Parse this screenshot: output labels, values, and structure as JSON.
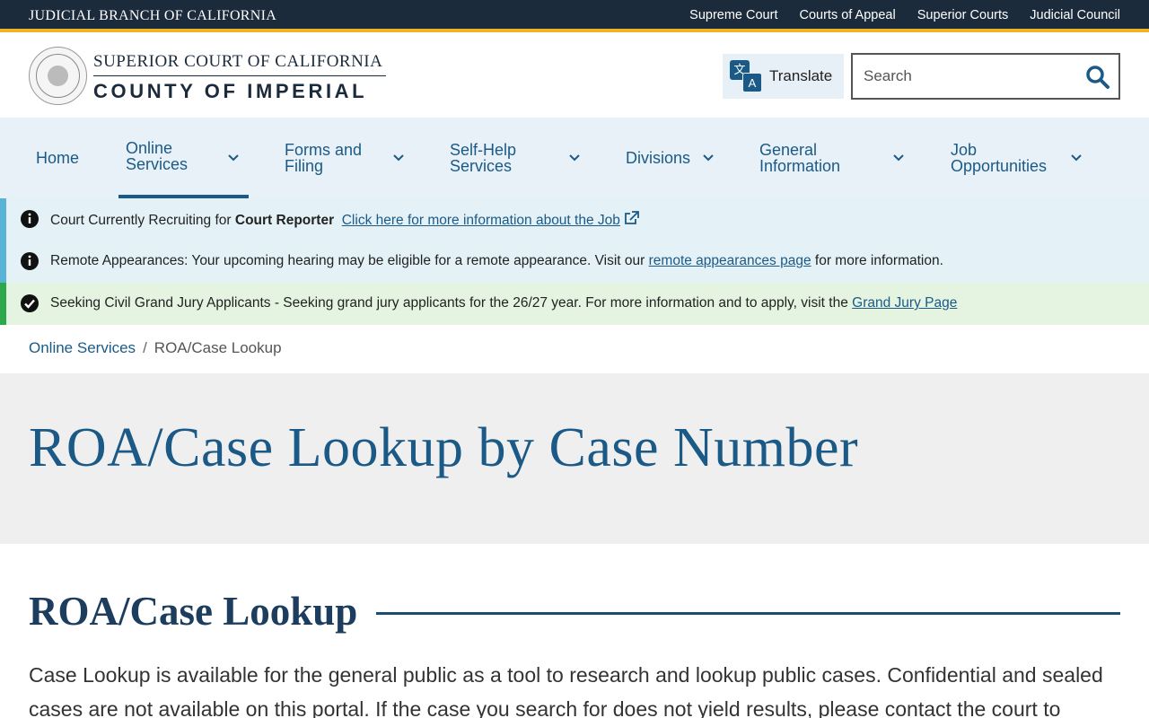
{
  "topbar": {
    "brand": "JUDICIAL BRANCH OF CALIFORNIA",
    "links": [
      "Supreme Court",
      "Courts of Appeal",
      "Superior Courts",
      "Judicial Council"
    ]
  },
  "header": {
    "court_line1": "SUPERIOR COURT OF CALIFORNIA",
    "court_line2": "COUNTY OF IMPERIAL",
    "translate_label": "Translate",
    "search_placeholder": "Search"
  },
  "nav": {
    "items": [
      {
        "label": "Home"
      },
      {
        "label": "Online Services",
        "line1": "Online",
        "line2": "Services"
      },
      {
        "label": "Forms and Filing",
        "line1": "Forms and",
        "line2": "Filing"
      },
      {
        "label": "Self-Help Services",
        "line1": "Self-Help",
        "line2": "Services"
      },
      {
        "label": "Divisions"
      },
      {
        "label": "General Information",
        "line1": "General",
        "line2": "Information"
      },
      {
        "label": "Job Opportunities",
        "line1": "Job",
        "line2": "Opportunities"
      }
    ]
  },
  "alerts": [
    {
      "type": "info",
      "prefix": "Court Currently Recruiting for ",
      "bold": "Court Reporter",
      "link": "Click here for more information about the Job"
    },
    {
      "type": "info",
      "text": "Remote Appearances: Your upcoming hearing may be eligible for a remote appearance. Visit our ",
      "link": "remote appearances page",
      "suffix": " for more information."
    },
    {
      "type": "success",
      "text": "Seeking Civil Grand Jury Applicants - Seeking grand jury applicants for the 26/27 year. For more information and to apply, visit the ",
      "link": "Grand Jury Page"
    }
  ],
  "breadcrumb": {
    "parent": "Online Services",
    "separator": "/",
    "current": "ROA/Case Lookup"
  },
  "page_title": "ROA/Case Lookup by Case Number",
  "section": {
    "title": "ROA/Case Lookup",
    "body": "Case Lookup is available for the general public as a tool to research and lookup public cases. Confidential and sealed cases are not available on this portal. If the case you search for does not yield results, please contact the court to"
  },
  "colors": {
    "primary": "#1b5a86",
    "topbar": "#1c2b3b",
    "accent": "#f0b323",
    "info_bar": "#58b4d6",
    "success_bar": "#2aa84a"
  }
}
